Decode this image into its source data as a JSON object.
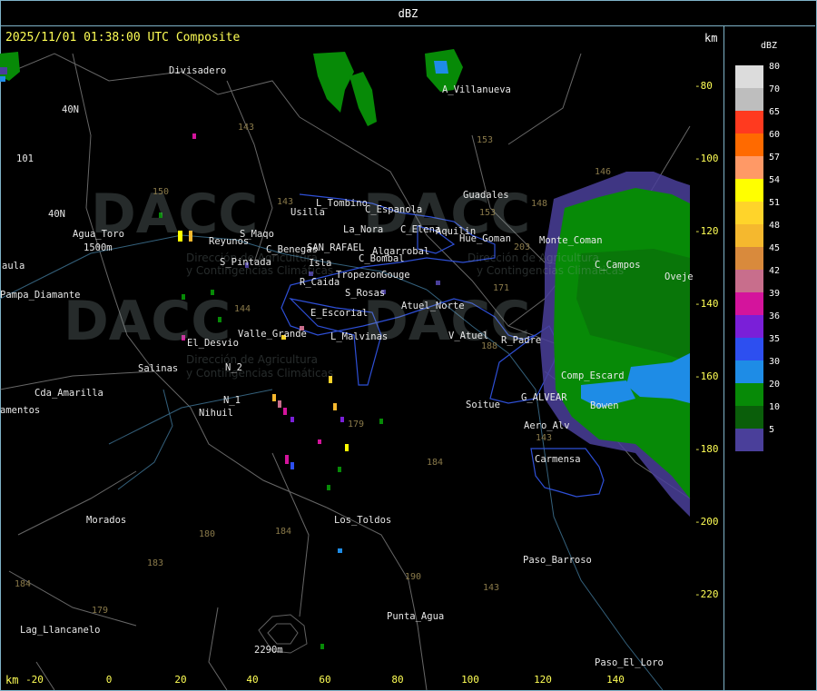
{
  "title": "dBZ",
  "timestamp": "2025/11/01 01:38:00 UTC Composite",
  "unit_label": "km",
  "x_ticks": [
    "-20",
    "0",
    "20",
    "40",
    "60",
    "80",
    "100",
    "120",
    "140"
  ],
  "y_ticks": [
    "-80",
    "-100",
    "-120",
    "-140",
    "-160",
    "-180",
    "-200",
    "-220"
  ],
  "legend": {
    "unit": "dBZ",
    "levels": [
      {
        "label": "80",
        "color": "#dcdcdc"
      },
      {
        "label": "70",
        "color": "#bebebe"
      },
      {
        "label": "65",
        "color": "#ff3a1f"
      },
      {
        "label": "60",
        "color": "#ff6a00"
      },
      {
        "label": "57",
        "color": "#ff9966"
      },
      {
        "label": "54",
        "color": "#ffff00"
      },
      {
        "label": "51",
        "color": "#ffd42a"
      },
      {
        "label": "48",
        "color": "#f5b82e"
      },
      {
        "label": "45",
        "color": "#d98a3c"
      },
      {
        "label": "42",
        "color": "#c86e8c"
      },
      {
        "label": "39",
        "color": "#d4149c"
      },
      {
        "label": "36",
        "color": "#7a1fd8"
      },
      {
        "label": "35",
        "color": "#2d4ff0"
      },
      {
        "label": "30",
        "color": "#1e8ce6"
      },
      {
        "label": "20",
        "color": "#078a07"
      },
      {
        "label": "10",
        "color": "#0a5e0a"
      },
      {
        "label": "5",
        "color": "#4a3f9a"
      }
    ]
  },
  "places": [
    "Divisadero",
    "A_Villanueva",
    "40N",
    "101",
    "40N",
    "Agua_Toro",
    "1500m",
    "aula",
    "Pampa_Diamante",
    "Reyunos",
    "S_Maqo",
    "S_Pintada",
    "El_Desvio",
    "Salinas",
    "N_2",
    "N_1",
    "Nihuil",
    "Valle_Grande",
    "Cda_Amarilla",
    "amentos",
    "Morados",
    "Lag_Llancanelo",
    "Punta_Agua",
    "Los_Toldos",
    "Paso_Barroso",
    "Paso_El_Loro",
    "Carmensa",
    "G_ALVEAR",
    "Soitue",
    "Aero_Alv",
    "Bowen",
    "V_Atuel",
    "R_Padre",
    "C_Campos",
    "Oveje",
    "Guadales",
    "Usilla",
    "L_Tombino",
    "C_Espanola",
    "La_Nora",
    "C_Elena",
    "Aquilin",
    "Hue_Goman",
    "SAN_RAFAEL",
    "Algarrobal",
    "C_Bombal",
    "C_Benegas",
    "Isla",
    "Tropezon",
    "Gouge",
    "R_Caida",
    "S_Rosas",
    "Atuel_Norte",
    "E_Escorial",
    "L_Malvinas",
    "Monte_Coman",
    "Comp_Escard",
    "2290m"
  ],
  "routes": [
    "143",
    "153",
    "150",
    "143",
    "144",
    "146",
    "148",
    "153",
    "203",
    "171",
    "188",
    "143",
    "179",
    "184",
    "180",
    "184",
    "183",
    "179",
    "190",
    "143",
    "184"
  ],
  "watermark": {
    "logo": "DACC",
    "line1": "Dirección de Agricultura",
    "line2": "y Contingencias Climáticas"
  }
}
